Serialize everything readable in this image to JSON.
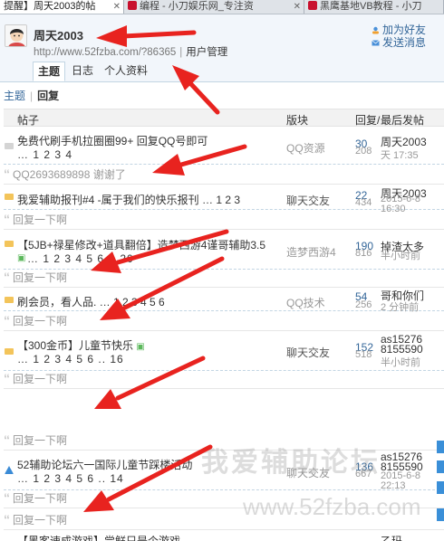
{
  "browser": {
    "tabs": [
      {
        "label": "提醒】周天2003的帖"
      },
      {
        "label": "编程 - 小刀娱乐网_专注资"
      },
      {
        "label": "黑鹰基地VB教程 - 小刀"
      }
    ]
  },
  "user": {
    "name": "周天2003",
    "url": "http://www.52fzba.com/?86365",
    "manage_label": "用户管理",
    "add_friend": "加为好友",
    "send_message": "发送消息",
    "tabs": [
      "主题",
      "日志",
      "个人资料"
    ]
  },
  "subnav": {
    "topic": "主题",
    "reply": "回复"
  },
  "list_header": {
    "post": "帖子",
    "forum": "版块",
    "replies": "回复/查看",
    "last": "最后发帖"
  },
  "threads": [
    {
      "title": "免费代刷手机拉圈圈99+ 回复QQ号即可",
      "pages": "… 1 2 3 4",
      "forum": "QQ资源",
      "replies": "30",
      "views": "208",
      "last_user": "周天2003",
      "last_time": "天 17:35",
      "quotes": [
        "QQ2693689898 谢谢了"
      ]
    },
    {
      "title": "我爱辅助报刊#4 -属于我们的快乐报刊 … 1 2 3",
      "pages": "",
      "forum": "聊天交友",
      "replies": "22",
      "views": "434",
      "last_user": "周天2003",
      "last_time": "2015-6-8 16:30",
      "quotes": [
        "回复一下啊"
      ]
    },
    {
      "title": "【5JB+禄星修改+道具翻倍】造梦西游4谨哥辅助3.5",
      "pages": "… 1 2 3 4 5 6 .. 20",
      "forum": "造梦西游4",
      "replies": "190",
      "views": "816",
      "last_user": "掉渣太多",
      "last_time": "半小时前",
      "quotes": [
        "回复一下啊"
      ]
    },
    {
      "title": "刷会员，看人品. … 1 2 3 4 5 6",
      "pages": "",
      "forum": "QQ技术",
      "replies": "54",
      "views": "256",
      "last_user": "哥和你们",
      "last_time": "2 分钟前",
      "quotes": [
        "回复一下啊"
      ]
    },
    {
      "title": "【300金币】儿童节快乐",
      "pages": "… 1 2 3 4 5 6 .. 16",
      "forum": "聊天交友",
      "replies": "152",
      "views": "518",
      "last_user": "as15276 8155590",
      "last_time": "半小时前",
      "quotes": [
        "回复一下啊",
        "回复一下啊"
      ]
    },
    {
      "title": "52辅助论坛六一国际儿童节踩楼活动",
      "pages": "… 1 2 3 4 5 6 .. 14",
      "forum": "聊天交友",
      "replies": "136",
      "views": "667",
      "last_user": "as15276 8155590",
      "last_time": "2015-6-8 22:13",
      "quotes": [
        "回复一下啊",
        "回复一下啊"
      ]
    },
    {
      "title": "【黑客速成游戏】尝鲜只是个游戏…",
      "pages": "",
      "forum": "",
      "replies": "",
      "views": "",
      "last_user": "乙玛",
      "last_time": "",
      "quotes": []
    }
  ],
  "watermark": {
    "text": "我爱辅助论坛",
    "url": "www.52fzba.com"
  },
  "colors": {
    "link": "#336699",
    "header_bg": "#f2f6fb",
    "border": "#c2d5e3",
    "arrow": "#e8231f"
  }
}
